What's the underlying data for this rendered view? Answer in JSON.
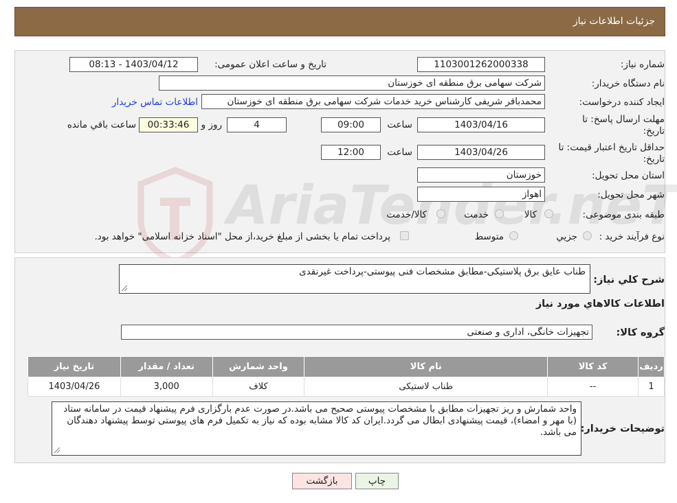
{
  "header": {
    "title": "جزئیات اطلاعات نیاز"
  },
  "form": {
    "need_number_label": "شماره نیاز:",
    "need_number": "1103001262000338",
    "announce_label": "تاریخ و ساعت اعلان عمومی:",
    "announce_value": "1403/04/12 - 08:13",
    "buyer_org_label": "نام دستگاه خريدار:",
    "buyer_org": "شرکت سهامی برق منطقه ای خوزستان",
    "creator_label": "ایجاد کننده درخواست:",
    "creator": "محمدباقر شریفی کارشناس خرید خدمات شرکت سهامی برق منطقه ای خوزستان",
    "contact_link": "اطلاعات تماس خریدار",
    "deadline_label_1": "مهلت ارسال پاسخ: تا",
    "deadline_label_2": "تاریخ:",
    "deadline_date": "1403/04/16",
    "time_label": "ساعت",
    "deadline_time": "09:00",
    "days_value": "4",
    "days_label": "روز و",
    "remaining_time": "00:33:46",
    "remaining_label": "ساعت باقي مانده",
    "validity_label_1": "حداقل تاریخ اعتبار قیمت: تا",
    "validity_label_2": "تاریخ:",
    "validity_date": "1403/04/26",
    "validity_time": "12:00",
    "province_label": "استان محل تحویل:",
    "province": "خوزستان",
    "city_label": "شهر محل تحویل:",
    "city": "اهواز",
    "category_label": "طبقه بندی موضوعی:",
    "category_options": [
      "کالا",
      "خدمت",
      "کالا/خدمت"
    ],
    "process_label": "نوع فرآیند خرید :",
    "process_options": [
      "جزیي",
      "متوسط"
    ],
    "process_note": "پرداخت تمام یا بخشی از مبلغ خرید،از محل \"اسناد خزانه اسلامی\" خواهد بود."
  },
  "description": {
    "label": "شرح کلي نياز:",
    "value": "طناب عایق برق پلاستیکی-مطابق مشخصات فنی پیوستی-پرداخت غیرنقدی"
  },
  "goods": {
    "section_title": "اطلاعات کالاهاي مورد نياز",
    "group_label": "گروه کالا:",
    "group_value": "تجهیزات خانگی، اداری و صنعتی",
    "columns": [
      "رديف",
      "کد کالا",
      "نام کالا",
      "واحد شمارش",
      "تعداد / مقدار",
      "تاريخ نياز"
    ],
    "rows": [
      [
        "1",
        "--",
        "طناب لاستیکی",
        "کلاف",
        "3,000",
        "1403/04/26"
      ]
    ]
  },
  "buyer_notes": {
    "label": "توضیحات خریدار:",
    "value": "واحد شمارش و ریز تجهیزات مطابق با مشخصات پیوستی صحیح می باشد.در صورت عدم بارگزاری فرم پیشنهاد قیمت در سامانه ستاد (با مهر و امضاء)، قیمت پیشنهادی ابطال می گردد.ایران کد کالا مشابه بوده که نیاز به تکمیل فرم های پیوستی توسط پیشنهاد دهندگان می باشد."
  },
  "buttons": {
    "print": "چاپ",
    "back": "بازگشت"
  },
  "watermark": {
    "text": "AriaTender.neT"
  },
  "colors": {
    "header_bg": "#8b6a45",
    "link": "#1a3fd6",
    "back_btn_bg": "#fde3e3",
    "print_btn_bg": "#eaf5e6",
    "table_header": "#9a9a9a"
  }
}
